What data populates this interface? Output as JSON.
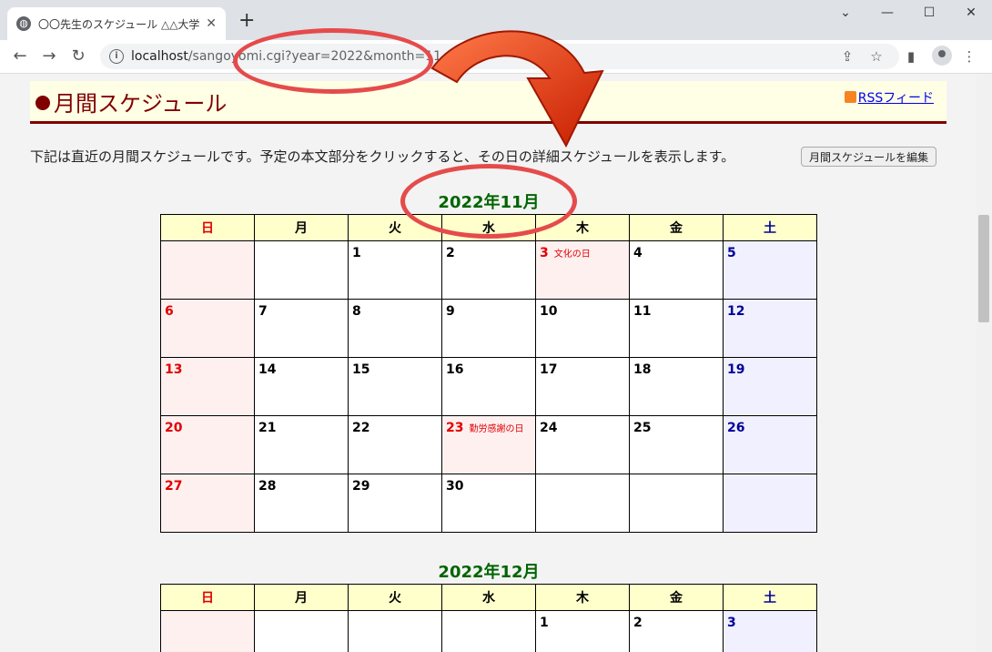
{
  "browser": {
    "tab_title": "〇〇先生のスケジュール △△大学☆",
    "url_host": "localhost",
    "url_path": "/sangoyomi.cgi?year=2022&month=11",
    "new_tab": "+",
    "win_min": "⌄",
    "win_min2": "—",
    "win_max": "☐",
    "win_close": "✕"
  },
  "header": {
    "title": "月間スケジュール",
    "rss": "RSSフィード"
  },
  "description": "下記は直近の月間スケジュールです。予定の本文部分をクリックすると、その日の詳細スケジュールを表示します。",
  "edit_button": "月間スケジュールを編集",
  "weekdays": [
    "日",
    "月",
    "火",
    "水",
    "木",
    "金",
    "土"
  ],
  "months": [
    {
      "title": "2022年11月",
      "weeks": [
        [
          {
            "d": ""
          },
          {
            "d": ""
          },
          {
            "d": "1"
          },
          {
            "d": "2"
          },
          {
            "d": "3",
            "h": "文化の日"
          },
          {
            "d": "4"
          },
          {
            "d": "5"
          }
        ],
        [
          {
            "d": "6"
          },
          {
            "d": "7"
          },
          {
            "d": "8"
          },
          {
            "d": "9"
          },
          {
            "d": "10"
          },
          {
            "d": "11"
          },
          {
            "d": "12"
          }
        ],
        [
          {
            "d": "13"
          },
          {
            "d": "14"
          },
          {
            "d": "15"
          },
          {
            "d": "16"
          },
          {
            "d": "17"
          },
          {
            "d": "18"
          },
          {
            "d": "19"
          }
        ],
        [
          {
            "d": "20"
          },
          {
            "d": "21"
          },
          {
            "d": "22"
          },
          {
            "d": "23",
            "h": "勤労感謝の日"
          },
          {
            "d": "24"
          },
          {
            "d": "25"
          },
          {
            "d": "26"
          }
        ],
        [
          {
            "d": "27"
          },
          {
            "d": "28"
          },
          {
            "d": "29"
          },
          {
            "d": "30"
          },
          {
            "d": ""
          },
          {
            "d": ""
          },
          {
            "d": ""
          }
        ]
      ]
    },
    {
      "title": "2022年12月",
      "weeks": [
        [
          {
            "d": ""
          },
          {
            "d": ""
          },
          {
            "d": ""
          },
          {
            "d": ""
          },
          {
            "d": "1"
          },
          {
            "d": "2"
          },
          {
            "d": "3"
          }
        ]
      ]
    }
  ],
  "colors": {
    "accent": "#800000",
    "heading": "#006400",
    "sunday": "#e00000",
    "saturday": "#000099",
    "annotation": "#e54b4b"
  }
}
